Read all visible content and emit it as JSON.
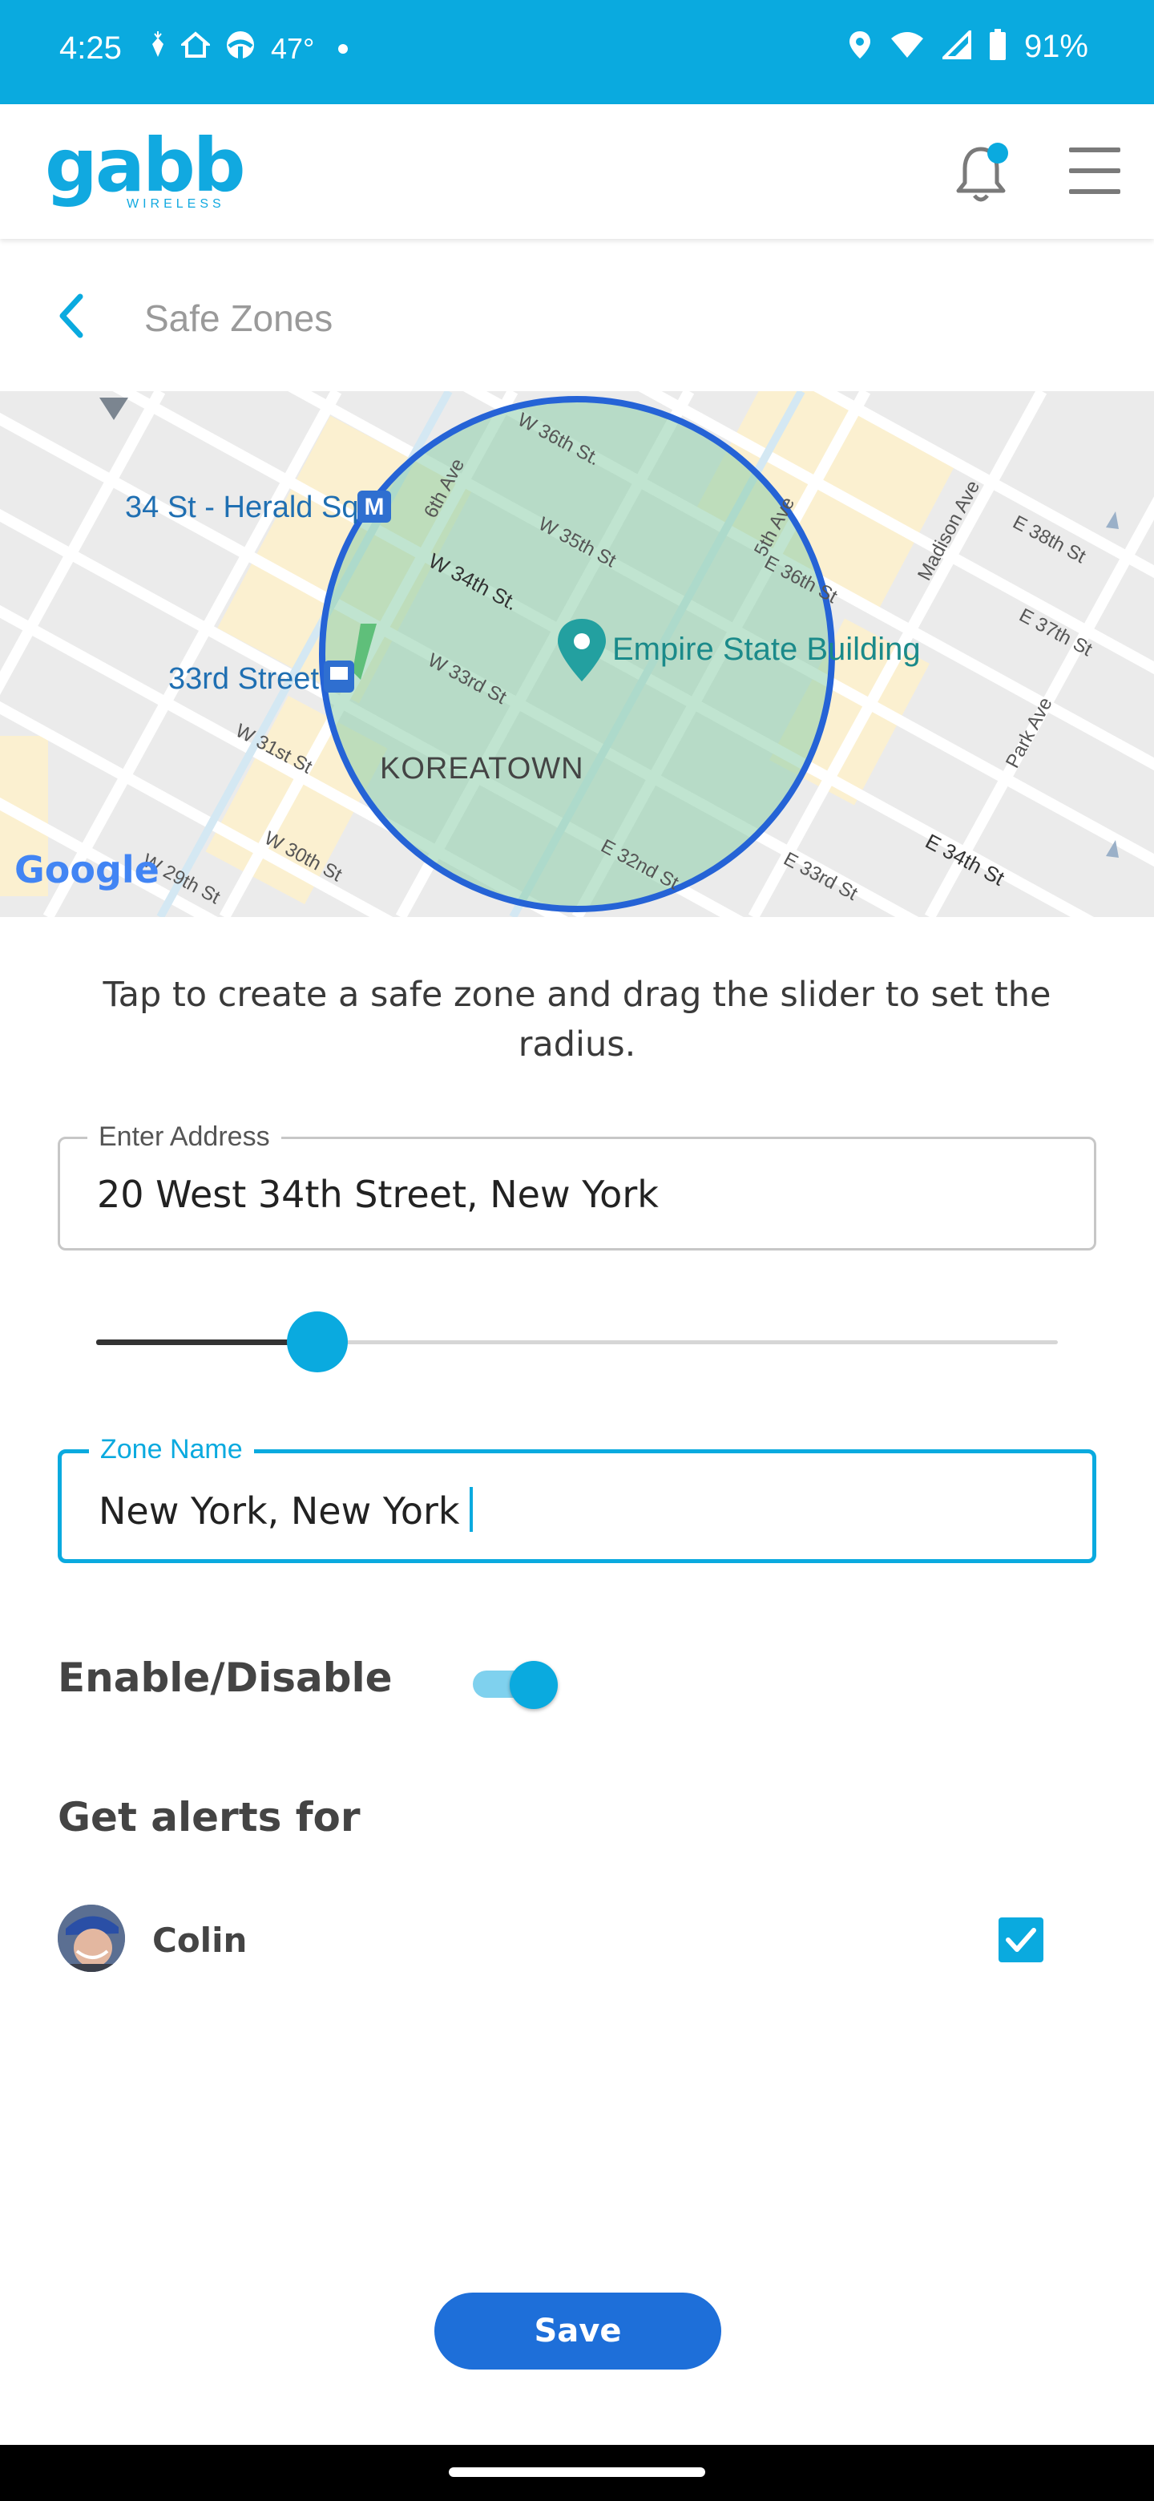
{
  "status_bar": {
    "time": "4:25",
    "temperature": "47°",
    "battery": "91%",
    "icons": [
      "carrot-icon",
      "home-icon",
      "weather-icon",
      "location-icon",
      "wifi-icon",
      "signal-icon",
      "battery-icon"
    ]
  },
  "header": {
    "logo_text": "gabb",
    "logo_sub": "WIRELESS",
    "notification_dot": true,
    "accent_color": "#0aaadf"
  },
  "page": {
    "title": "Safe Zones"
  },
  "map": {
    "poi": {
      "herald_sq": "34 St - Herald Sq",
      "third_street": "33rd Street",
      "empire_state": "Empire State Building",
      "koreatown": "KOREATOWN"
    },
    "streets": {
      "w36": "W 36th St.",
      "w35": "W 35th St",
      "w34": "W 34th St.",
      "w33": "W 33rd St",
      "w31": "W 31st St",
      "w30": "W 30th St",
      "w29": "W 29th St",
      "sixth": "6th Ave",
      "fifth": "5th Ave",
      "e36": "E 36th St",
      "e38": "E 38th St",
      "e37": "E 37th St",
      "e34": "E 34th St",
      "e33": "E 33rd St",
      "e32": "E 32nd St",
      "madison": "Madison Ave",
      "park": "Park Ave"
    },
    "attribution": "Google"
  },
  "instructions": "Tap to create a safe zone and drag the slider to set the radius.",
  "address_field": {
    "label": "Enter Address",
    "value": "20 West 34th Street, New York"
  },
  "radius_slider": {
    "fraction": 0.23
  },
  "zone_name_field": {
    "label": "Zone Name",
    "value": "New York, New York"
  },
  "enable": {
    "label": "Enable/Disable",
    "on": true
  },
  "alerts": {
    "title": "Get alerts for",
    "people": [
      {
        "name": "Colin",
        "checked": true
      }
    ]
  },
  "save_label": "Save"
}
